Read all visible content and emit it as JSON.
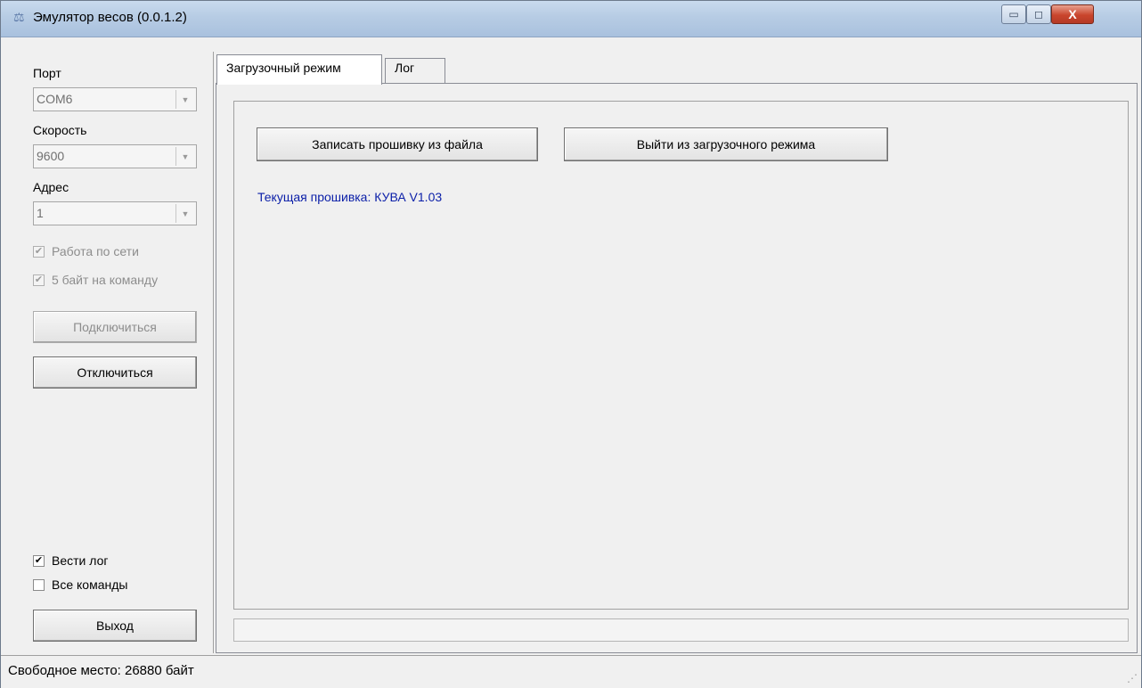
{
  "window": {
    "title": "Эмулятор весов (0.0.1.2)",
    "icon": "scales-icon",
    "controls": {
      "minimize": "▭",
      "maximize": "◻",
      "close": "X"
    }
  },
  "sidebar": {
    "port_label": "Порт",
    "port_value": "COM6",
    "speed_label": "Скорость",
    "speed_value": "9600",
    "address_label": "Адрес",
    "address_value": "1",
    "network_label": "Работа по сети",
    "network_checked": true,
    "five_bytes_label": "5 байт на команду",
    "five_bytes_checked": true,
    "connect_label": "Подключиться",
    "disconnect_label": "Отключиться",
    "log_label": "Вести лог",
    "log_checked": true,
    "all_commands_label": "Все команды",
    "all_commands_checked": false,
    "exit_label": "Выход"
  },
  "tabs": [
    {
      "label": "Загрузочный режим",
      "active": true
    },
    {
      "label": "Лог",
      "active": false
    }
  ],
  "bootloader": {
    "write_firmware_label": "Записать прошивку из файла",
    "exit_boot_label": "Выйти из загрузочного режима",
    "current_firmware": "Текущая прошивка: КУВА V1.03"
  },
  "status": {
    "free_space": "Свободное место: 26880 байт"
  }
}
